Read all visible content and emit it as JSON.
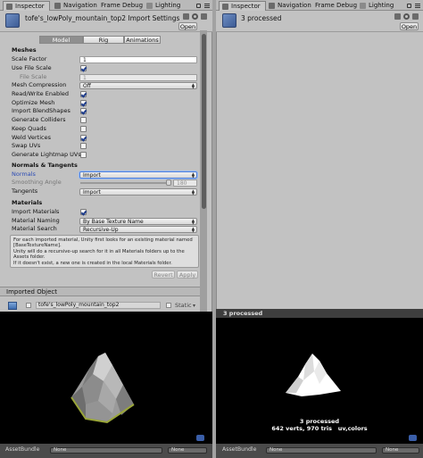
{
  "left_tabs": [
    {
      "label": "Inspector",
      "active": true
    },
    {
      "label": "Navigation",
      "active": false
    },
    {
      "label": "Frame Debug",
      "active": false
    },
    {
      "label": "Lighting",
      "active": false
    }
  ],
  "right_tabs": [
    {
      "label": "Inspector",
      "active": true
    },
    {
      "label": "Navigation",
      "active": false
    },
    {
      "label": "Frame Debug",
      "active": false
    },
    {
      "label": "Lighting",
      "active": false
    }
  ],
  "left_header": {
    "title": "tofe's_lowPoly_mountain_top2 Import Settings",
    "open_label": "Open"
  },
  "right_header": {
    "title": "3 processed",
    "open_label": "Open"
  },
  "import_tabs": [
    {
      "label": "Model",
      "active": true
    },
    {
      "label": "Rig",
      "active": false
    },
    {
      "label": "Animations",
      "active": false
    }
  ],
  "meshes": {
    "heading": "Meshes",
    "scale_factor_label": "Scale Factor",
    "scale_factor_value": "1",
    "use_file_scale_label": "Use File Scale",
    "use_file_scale": true,
    "file_scale_label": "File Scale",
    "file_scale_value": "1",
    "mesh_compression_label": "Mesh Compression",
    "mesh_compression_value": "Off",
    "read_write_label": "Read/Write Enabled",
    "read_write": true,
    "optimize_mesh_label": "Optimize Mesh",
    "optimize_mesh": true,
    "import_blendshapes_label": "Import BlendShapes",
    "import_blendshapes": true,
    "generate_colliders_label": "Generate Colliders",
    "generate_colliders": false,
    "keep_quads_label": "Keep Quads",
    "keep_quads": false,
    "weld_vertices_label": "Weld Vertices",
    "weld_vertices": true,
    "swap_uvs_label": "Swap UVs",
    "swap_uvs": false,
    "lightmap_uvs_label": "Generate Lightmap UVs",
    "lightmap_uvs": false
  },
  "normals_tangents": {
    "heading": "Normals & Tangents",
    "normals_label": "Normals",
    "normals_value": "Import",
    "smoothing_label": "Smoothing Angle",
    "smoothing_value": "180",
    "smoothing_fraction": 1.0,
    "tangents_label": "Tangents",
    "tangents_value": "Import"
  },
  "materials": {
    "heading": "Materials",
    "import_materials_label": "Import Materials",
    "import_materials": true,
    "naming_label": "Material Naming",
    "naming_value": "By Base Texture Name",
    "search_label": "Material Search",
    "search_value": "Recursive-Up",
    "help_lines": [
      "For each imported material, Unity first looks for an existing material named",
      "[BaseTextureName].",
      "Unity will do a recursive-up search for it in all Materials folders up to the",
      "Assets folder.",
      "If it doesn't exist, a new one is created in the local Materials folder."
    ]
  },
  "actions": {
    "revert_label": "Revert",
    "apply_label": "Apply"
  },
  "imported_object": {
    "title": "Imported Object",
    "name": "tofe's_lowPoly_mountain_top2",
    "static_label": "Static"
  },
  "left_preview": {
    "assetbundle_label": "AssetBundle",
    "bundle_value": "None",
    "variant_value": "None"
  },
  "right_preview": {
    "top_label": "3 processed",
    "caption_line1": "3 processed",
    "caption_line2": "642 verts, 970 tris   uv,colors",
    "assetbundle_label": "AssetBundle",
    "bundle_value": "None",
    "variant_value": "None"
  },
  "colors": {
    "panel": "#c2c2c2",
    "accent_blue": "#2b4bb5",
    "preview_bg": "#000000"
  }
}
